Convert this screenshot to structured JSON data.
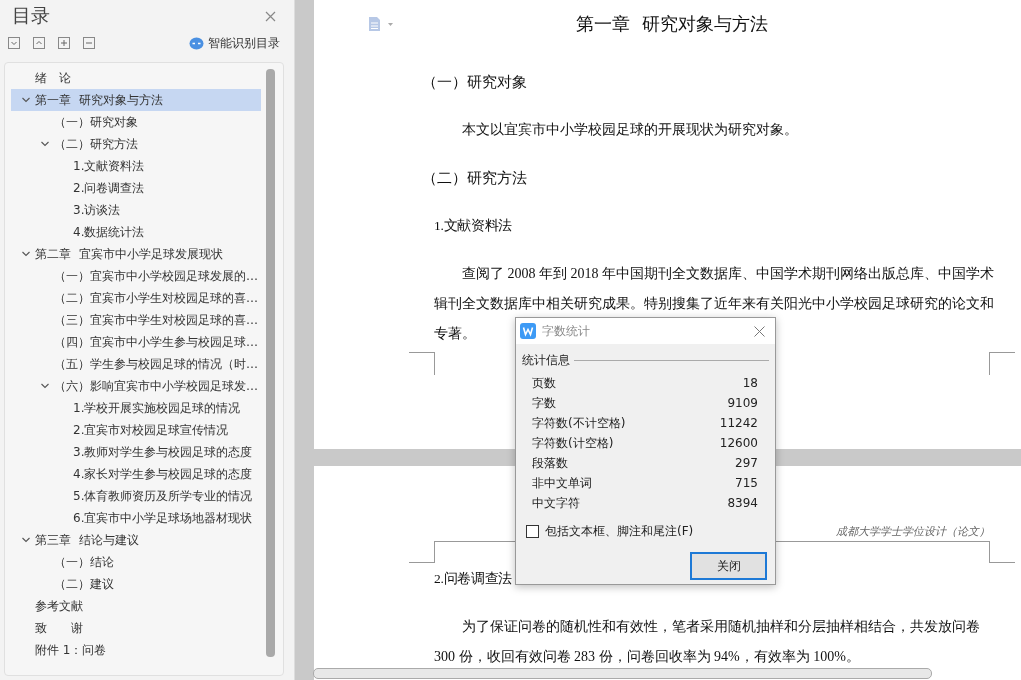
{
  "sidebar": {
    "title": "目录",
    "smart_toc_button": "智能识别目录",
    "tree": [
      {
        "label": "绪　论",
        "selected": false
      },
      {
        "label": "第一章  研究对象与方法",
        "selected": true,
        "expanded": true,
        "children": [
          {
            "label": "（一）研究对象",
            "selected": false
          },
          {
            "label": "（二）研究方法",
            "selected": false,
            "expanded": true,
            "children": [
              {
                "label": "1.文献资料法",
                "selected": false
              },
              {
                "label": "2.问卷调查法",
                "selected": false
              },
              {
                "label": "3.访谈法",
                "selected": false
              },
              {
                "label": "4.数据统计法",
                "selected": false
              }
            ]
          }
        ]
      },
      {
        "label": "第二章  宜宾市中小学足球发展现状",
        "selected": false,
        "expanded": true,
        "children": [
          {
            "label": "（一）宜宾市中小学校园足球发展的…",
            "selected": false
          },
          {
            "label": "（二）宜宾市小学生对校园足球的喜…",
            "selected": false
          },
          {
            "label": "（三）宜宾市中学生对校园足球的喜…",
            "selected": false
          },
          {
            "label": "（四）宜宾市中小学生参与校园足球…",
            "selected": false
          },
          {
            "label": "（五）学生参与校园足球的情况（时…",
            "selected": false
          },
          {
            "label": "（六）影响宜宾市中小学校园足球发…",
            "selected": false,
            "expanded": true,
            "children": [
              {
                "label": "1.学校开展实施校园足球的情况",
                "selected": false
              },
              {
                "label": "2.宜宾市对校园足球宣传情况",
                "selected": false
              },
              {
                "label": "3.教师对学生参与校园足球的态度",
                "selected": false
              },
              {
                "label": "4.家长对学生参与校园足球的态度",
                "selected": false
              },
              {
                "label": "5.体育教师资历及所学专业的情况",
                "selected": false
              },
              {
                "label": "6.宜宾市中小学足球场地器材现状",
                "selected": false
              }
            ]
          }
        ]
      },
      {
        "label": "第三章  结论与建议",
        "selected": false,
        "expanded": true,
        "children": [
          {
            "label": "（一）结论",
            "selected": false
          },
          {
            "label": "（二）建议",
            "selected": false
          }
        ]
      },
      {
        "label": "参考文献",
        "selected": false
      },
      {
        "label": "致　　谢",
        "selected": false
      },
      {
        "label": "附件 1：问卷",
        "selected": false
      }
    ]
  },
  "document": {
    "page_1": {
      "title": "第一章  研究对象与方法",
      "blocks": [
        {
          "kind": "heading",
          "text": "（一）研究对象"
        },
        {
          "kind": "paragraph",
          "lines": [
            "本文以宜宾市中小学校园足球的开展现状为研究对象。"
          ]
        },
        {
          "kind": "heading",
          "text": "（二）研究方法"
        },
        {
          "kind": "subheading",
          "text": "1.文献资料法"
        },
        {
          "kind": "paragraph",
          "lines": [
            "查阅了 2008 年到 2018 年中国期刊全文数据库、中国学术期刊网络出版总库、中国学术",
            "辑刊全文数据库中相关研究成果。特别搜集了近年来有关阳光中小学校园足球研究的论文和",
            "专著。"
          ]
        }
      ]
    },
    "page_2": {
      "header": "成都大学学士学位设计（论文）",
      "blocks": [
        {
          "kind": "subheading",
          "text": "2.问卷调查法"
        },
        {
          "kind": "paragraph",
          "lines": [
            "为了保证问卷的随机性和有效性，笔者采用随机抽样和分层抽样相结合，共发放问卷",
            "300 份，收回有效问卷 283 份，问卷回收率为 94%，有效率为 100%。"
          ]
        }
      ]
    }
  },
  "dialog": {
    "title": "字数统计",
    "group_label": "统计信息",
    "stats": [
      {
        "label": "页数",
        "value": "18"
      },
      {
        "label": "字数",
        "value": "9109"
      },
      {
        "label": "字符数(不计空格)",
        "value": "11242"
      },
      {
        "label": "字符数(计空格)",
        "value": "12600"
      },
      {
        "label": "段落数",
        "value": "297"
      },
      {
        "label": "非中文单词",
        "value": "715"
      },
      {
        "label": "中文字符",
        "value": "8394"
      }
    ],
    "checkbox": {
      "label": "包括文本框、脚注和尾注(F)",
      "checked": false
    },
    "button": "关闭"
  }
}
